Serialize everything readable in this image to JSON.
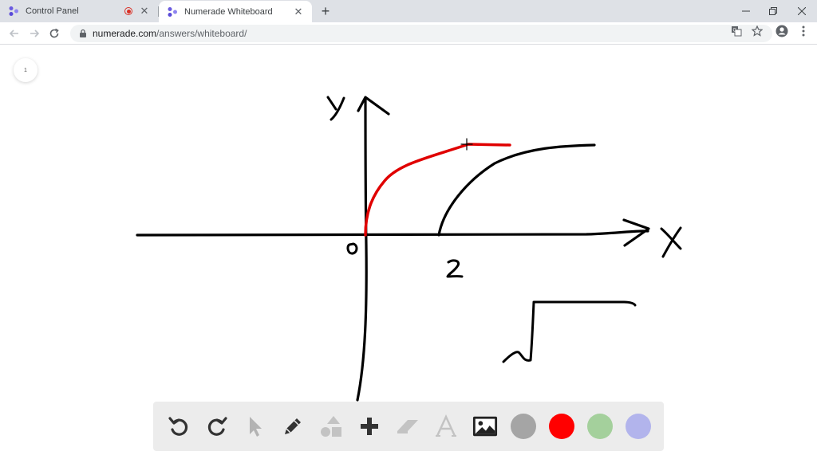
{
  "browser": {
    "tabs": [
      {
        "title": "Control Panel",
        "recording": true,
        "active": false
      },
      {
        "title": "Numerade Whiteboard",
        "recording": false,
        "active": true
      }
    ],
    "url_domain": "numerade.com",
    "url_path": "/answers/whiteboard/"
  },
  "whiteboard": {
    "page_number": "1",
    "handwritten_labels": [
      "y",
      "x",
      "0",
      "2"
    ],
    "tools": [
      {
        "name": "undo",
        "icon": "undo-icon"
      },
      {
        "name": "redo",
        "icon": "redo-icon"
      },
      {
        "name": "select",
        "icon": "pointer-icon"
      },
      {
        "name": "pen",
        "icon": "pencil-icon"
      },
      {
        "name": "shapes",
        "icon": "shapes-icon"
      },
      {
        "name": "add",
        "icon": "plus-icon"
      },
      {
        "name": "eraser",
        "icon": "eraser-icon"
      },
      {
        "name": "text",
        "icon": "text-icon"
      },
      {
        "name": "image",
        "icon": "image-icon"
      }
    ],
    "colors": [
      "#a5a5a5",
      "#ff0000",
      "#a4d09c",
      "#b2b4ec"
    ],
    "selected_color": "#ff0000",
    "ink_colors": [
      "#000000",
      "#e00000"
    ]
  }
}
